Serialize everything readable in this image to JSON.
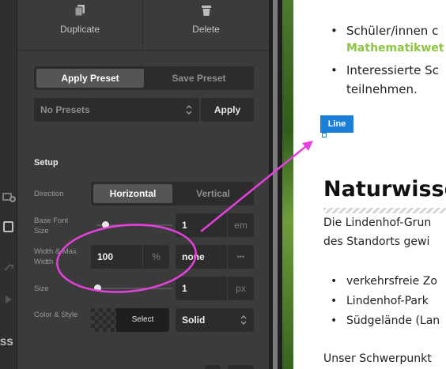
{
  "left_strip": {
    "icons": [
      "add-layer-icon",
      "square-icon",
      "link-icon",
      "arrow-icon"
    ],
    "label": "SS"
  },
  "panel": {
    "top_actions": {
      "duplicate_label": "Duplicate",
      "delete_label": "Delete"
    },
    "preset_tabs": {
      "apply_label": "Apply Preset",
      "save_label": "Save Preset"
    },
    "preset_select": {
      "value": "No Presets"
    },
    "apply_button": "Apply",
    "setup_title": "Setup",
    "direction": {
      "label": "Direction",
      "options": [
        "Horizontal",
        "Vertical"
      ],
      "active": "Horizontal"
    },
    "base_font_size": {
      "label": "Base Font Size",
      "value": "1",
      "unit": "em",
      "slider": 0.15
    },
    "width": {
      "label": "Width & Max Width",
      "value": "100",
      "unit": "%",
      "max_value": "none",
      "max_unit": "•••"
    },
    "size": {
      "label": "Size",
      "value": "1",
      "unit": "px",
      "slider": 0.0
    },
    "color_style": {
      "label": "Color & Style",
      "select_label": "Select",
      "style_value": "Solid"
    }
  },
  "page": {
    "bullets_top": [
      "Schüler/innen c",
      "Interessierte Sc"
    ],
    "green_text": "Mathematikwet",
    "continuation": "teilnehmen.",
    "line_tag": "Line",
    "heading": "Naturwisse",
    "para_lines": [
      "Die Lindenhof-Grun",
      "des Standorts gewi"
    ],
    "bullets_bottom": [
      "verkehrsfreie Zo",
      "Lindenhof-Park",
      "Südgelände (Lan"
    ],
    "footer": "Unser Schwerpunkt"
  },
  "colors": {
    "annotation": "#e83fe0",
    "line_tag": "#1a7fd6",
    "green": "#8cc63f"
  }
}
